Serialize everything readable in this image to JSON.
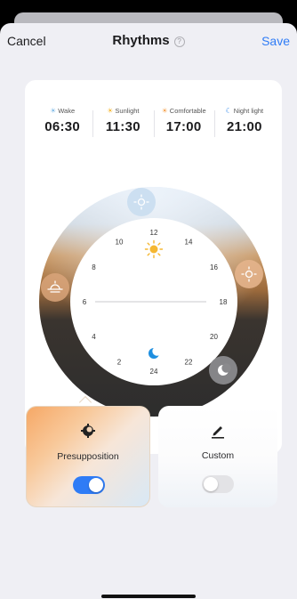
{
  "nav": {
    "cancel": "Cancel",
    "title": "Rhythms",
    "help": "?",
    "save": "Save"
  },
  "times": [
    {
      "label": "Wake",
      "time": "06:30",
      "icon": "wake-icon",
      "color": "#7ab7e6"
    },
    {
      "label": "Sunlight",
      "time": "11:30",
      "icon": "sun-icon",
      "color": "#f5b731"
    },
    {
      "label": "Comfortable",
      "time": "17:00",
      "icon": "sunset-icon",
      "color": "#f5a04a"
    },
    {
      "label": "Night light",
      "time": "21:00",
      "icon": "moon-icon",
      "color": "#1f7ee8"
    }
  ],
  "dial": {
    "hours": [
      "12",
      "14",
      "16",
      "18",
      "20",
      "22",
      "24",
      "2",
      "4",
      "6",
      "8",
      "10"
    ]
  },
  "modes": [
    {
      "label": "Presupposition",
      "icon": "sun-gear-icon",
      "enabled": true
    },
    {
      "label": "Custom",
      "icon": "pencil-icon",
      "enabled": false
    }
  ],
  "colors": {
    "accent": "#2f7cf6",
    "sun": "#f5b731",
    "moon": "#1e8fe0"
  }
}
